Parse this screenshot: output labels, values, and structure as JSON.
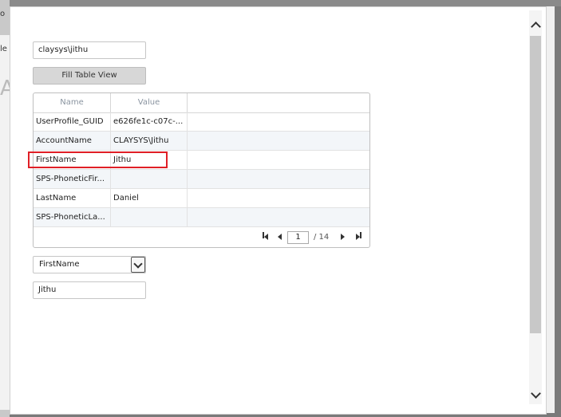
{
  "background": {
    "frag_a": "o",
    "frag_b": "le",
    "frag_c": "A"
  },
  "user_input": {
    "value": "claysys\\jithu"
  },
  "fill_button": {
    "label": "Fill Table View"
  },
  "table": {
    "columns": [
      "Name",
      "Value"
    ],
    "rows": [
      {
        "name": "UserProfile_GUID",
        "value": "e626fe1c-c07c-..."
      },
      {
        "name": "AccountName",
        "value": "CLAYSYS\\Jithu"
      },
      {
        "name": "FirstName",
        "value": "Jithu"
      },
      {
        "name": "SPS-PhoneticFir...",
        "value": ""
      },
      {
        "name": "LastName",
        "value": "Daniel"
      },
      {
        "name": "SPS-PhoneticLa...",
        "value": ""
      }
    ],
    "highlighted_row": 2
  },
  "pager": {
    "current_page": "1",
    "total_label": "/ 14"
  },
  "property_select": {
    "selected": "FirstName"
  },
  "result_input": {
    "value": "Jithu"
  },
  "colors": {
    "highlight": "#e01f26",
    "button": "#d7d7d7",
    "alt_row": "#f3f6f9"
  }
}
